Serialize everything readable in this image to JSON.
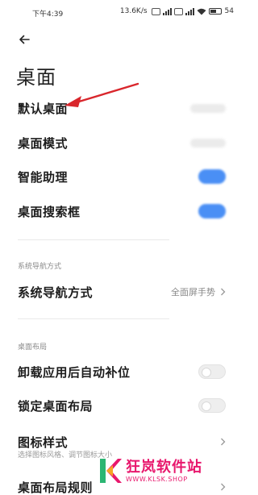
{
  "status_bar": {
    "time": "下午4:39",
    "speed": "13.6K/s",
    "battery": "54"
  },
  "header": {
    "title": "桌面"
  },
  "settings": [
    {
      "label": "默认桌面",
      "control": "value-blurred"
    },
    {
      "label": "桌面模式",
      "control": "value-blurred"
    },
    {
      "label": "智能助理",
      "control": "toggle",
      "enabled": true
    },
    {
      "label": "桌面搜索框",
      "control": "toggle",
      "enabled": true
    }
  ],
  "nav_section": {
    "heading": "系统导航方式",
    "item_label": "系统导航方式",
    "item_value": "全面屏手势"
  },
  "layout_section": {
    "heading": "桌面布局",
    "items": [
      {
        "label": "卸载应用后自动补位",
        "control": "toggle",
        "enabled": false
      },
      {
        "label": "锁定桌面布局",
        "control": "toggle",
        "enabled": false
      },
      {
        "label": "图标样式",
        "subtitle": "选择图标风格、调节图标大小",
        "control": "chevron"
      },
      {
        "label": "桌面布局规则",
        "control": "chevron"
      }
    ]
  },
  "watermark": {
    "title": "狂岚软件站",
    "url": "WWW.KLSK.SHOP"
  },
  "colors": {
    "toggle_on": "#4a8ff5",
    "annotation_arrow": "#d9262c",
    "watermark": "#e8186d"
  }
}
